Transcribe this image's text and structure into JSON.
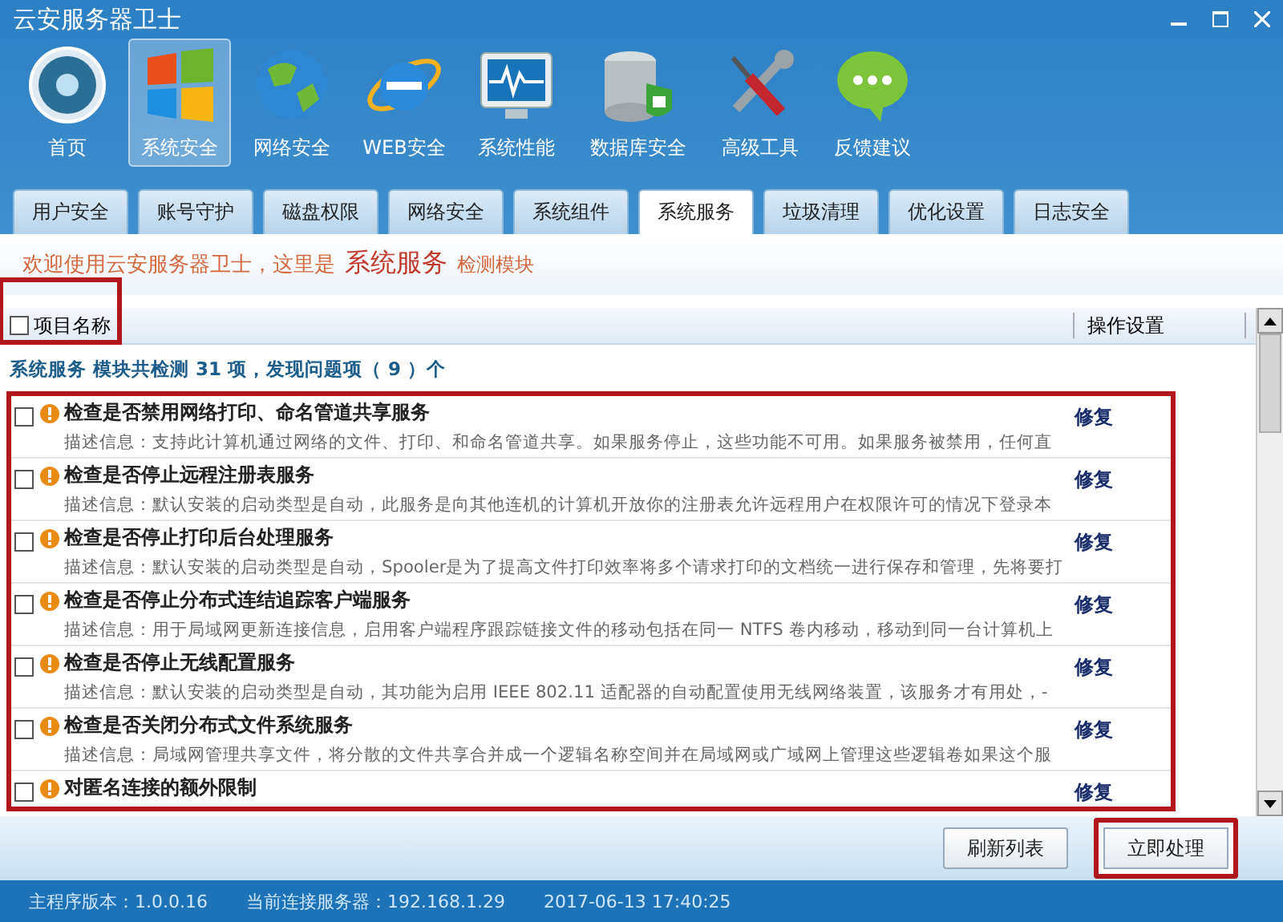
{
  "window": {
    "title": "云安服务器卫士"
  },
  "nav": [
    {
      "label": "首页",
      "selected": false
    },
    {
      "label": "系统安全",
      "selected": true
    },
    {
      "label": "网络安全",
      "selected": false
    },
    {
      "label": "WEB安全",
      "selected": false
    },
    {
      "label": "系统性能",
      "selected": false
    },
    {
      "label": "数据库安全",
      "selected": false
    },
    {
      "label": "高级工具",
      "selected": false
    },
    {
      "label": "反馈建议",
      "selected": false
    }
  ],
  "tabs": [
    {
      "label": "用户安全",
      "selected": false
    },
    {
      "label": "账号守护",
      "selected": false
    },
    {
      "label": "磁盘权限",
      "selected": false
    },
    {
      "label": "网络安全",
      "selected": false
    },
    {
      "label": "系统组件",
      "selected": false
    },
    {
      "label": "系统服务",
      "selected": true
    },
    {
      "label": "垃圾清理",
      "selected": false
    },
    {
      "label": "优化设置",
      "selected": false
    },
    {
      "label": "日志安全",
      "selected": false
    }
  ],
  "welcome": {
    "prefix": "欢迎使用云安服务器卫士，这里是",
    "module": "系统服务",
    "suffix": "检测模块"
  },
  "table": {
    "columns": [
      {
        "label": "项目名称",
        "checked": false,
        "highlighted": true
      },
      {
        "label": "操作设置"
      }
    ],
    "summary": "系统服务 模块共检测 31 项，发现问题项（ 9 ）个",
    "highlighted": true,
    "rows": [
      {
        "title": "检查是否禁用网络打印、命名管道共享服务",
        "description": "描述信息：支持此计算机通过网络的文件、打印、和命名管道共享。如果服务停止，这些功能不可用。如果服务被禁用，任何直",
        "action": "修复",
        "checked": false
      },
      {
        "title": "检查是否停止远程注册表服务",
        "description": "描述信息：默认安装的启动类型是自动，此服务是向其他连机的计算机开放你的注册表允许远程用户在权限许可的情况下登录本",
        "action": "修复",
        "checked": false
      },
      {
        "title": "检查是否停止打印后台处理服务",
        "description": "描述信息：默认安装的启动类型是自动，Spooler是为了提高文件打印效率将多个请求打印的文档统一进行保存和管理，先将要打",
        "action": "修复",
        "checked": false
      },
      {
        "title": "检查是否停止分布式连结追踪客户端服务",
        "description": "描述信息：用于局域网更新连接信息，启用客户端程序跟踪链接文件的移动包括在同一 NTFS 卷内移动，移动到同一台计算机上",
        "action": "修复",
        "checked": false
      },
      {
        "title": "检查是否停止无线配置服务",
        "description": "描述信息：默认安装的启动类型是自动，其功能为启用 IEEE 802.11 适配器的自动配置使用无线网络装置，该服务才有用处，-",
        "action": "修复",
        "checked": false
      },
      {
        "title": "检查是否关闭分布式文件系统服务",
        "description": "描述信息：局域网管理共享文件，将分散的文件共享合并成一个逻辑名称空间并在局域网或广域网上管理这些逻辑卷如果这个服",
        "action": "修复",
        "checked": false
      },
      {
        "title": "对匿名连接的额外限制",
        "action": "修复",
        "checked": false
      }
    ]
  },
  "buttons": [
    {
      "label": "刷新列表",
      "highlighted": false
    },
    {
      "label": "立即处理",
      "highlighted": true
    }
  ],
  "status_bar": [
    {
      "label": "主程序版本：1.0.0.16"
    },
    {
      "label": "当前连接服务器：192.168.1.29"
    },
    {
      "label": "2017-06-13 17:40:25"
    }
  ]
}
